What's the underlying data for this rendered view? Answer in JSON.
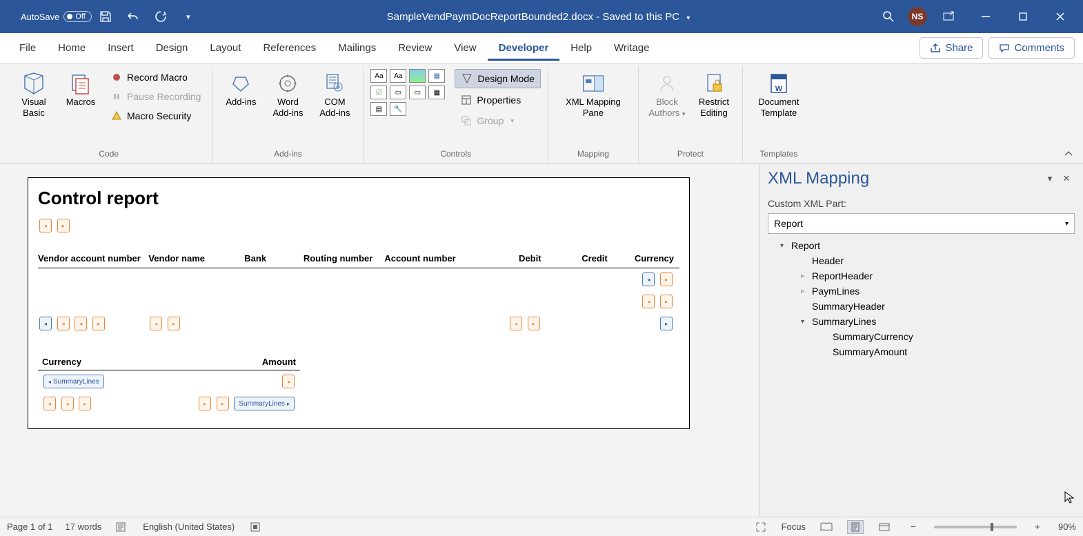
{
  "titlebar": {
    "autosave_label": "AutoSave",
    "autosave_state": "Off",
    "filename": "SampleVendPaymDocReportBounded2.docx",
    "save_state": "Saved to this PC",
    "user_initials": "NS"
  },
  "tabs": {
    "file": "File",
    "home": "Home",
    "insert": "Insert",
    "design": "Design",
    "layout": "Layout",
    "references": "References",
    "mailings": "Mailings",
    "review": "Review",
    "view": "View",
    "developer": "Developer",
    "help": "Help",
    "writage": "Writage"
  },
  "actions": {
    "share": "Share",
    "comments": "Comments"
  },
  "ribbon": {
    "code": {
      "group": "Code",
      "visual_basic": "Visual Basic",
      "macros": "Macros",
      "record_macro": "Record Macro",
      "pause_recording": "Pause Recording",
      "macro_security": "Macro Security"
    },
    "addins": {
      "group": "Add-ins",
      "addins": "Add-ins",
      "word_addins": "Word Add-ins",
      "com_addins": "COM Add-ins"
    },
    "controls": {
      "group": "Controls",
      "design_mode": "Design Mode",
      "properties": "Properties",
      "group_cmd": "Group"
    },
    "mapping": {
      "group": "Mapping",
      "xml_mapping_pane": "XML Mapping Pane"
    },
    "protect": {
      "group": "Protect",
      "block_authors": "Block Authors",
      "restrict_editing": "Restrict Editing"
    },
    "templates": {
      "group": "Templates",
      "document_template": "Document Template"
    }
  },
  "document": {
    "title": "Control report",
    "table1_headers": {
      "vendor_account": "Vendor account number",
      "vendor_name": "Vendor name",
      "bank": "Bank",
      "routing_number": "Routing number",
      "account_number": "Account number",
      "debit": "Debit",
      "credit": "Credit",
      "currency": "Currency"
    },
    "table2_headers": {
      "currency": "Currency",
      "amount": "Amount"
    },
    "cc_summary_lines": "SummaryLines"
  },
  "xml_pane": {
    "title": "XML Mapping",
    "part_label": "Custom XML Part:",
    "selected_part": "Report",
    "tree": {
      "root": "Report",
      "header": "Header",
      "report_header": "ReportHeader",
      "paym_lines": "PaymLines",
      "summary_header": "SummaryHeader",
      "summary_lines": "SummaryLines",
      "summary_currency": "SummaryCurrency",
      "summary_amount": "SummaryAmount"
    }
  },
  "statusbar": {
    "page": "Page 1 of 1",
    "words": "17 words",
    "language": "English (United States)",
    "focus": "Focus",
    "zoom": "90%"
  }
}
